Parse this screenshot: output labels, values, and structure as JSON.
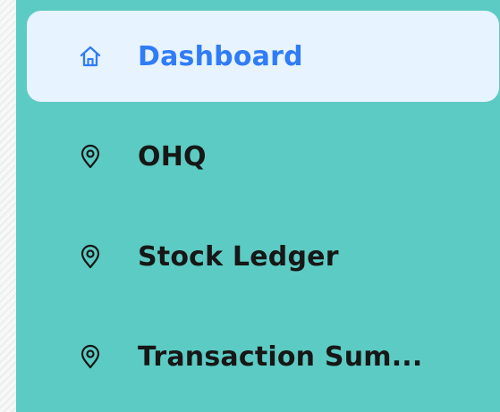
{
  "sidebar": {
    "items": [
      {
        "label": "Dashboard",
        "icon": "home-icon",
        "active": true
      },
      {
        "label": "OHQ",
        "icon": "location-pin-icon",
        "active": false
      },
      {
        "label": "Stock Ledger",
        "icon": "location-pin-icon",
        "active": false
      },
      {
        "label": "Transaction Sum...",
        "icon": "location-pin-icon",
        "active": false
      }
    ]
  },
  "colors": {
    "sidebar_bg": "#5ccbc3",
    "active_bg": "#e7f3ff",
    "active_text": "#2f7cf6",
    "text": "#171717"
  }
}
